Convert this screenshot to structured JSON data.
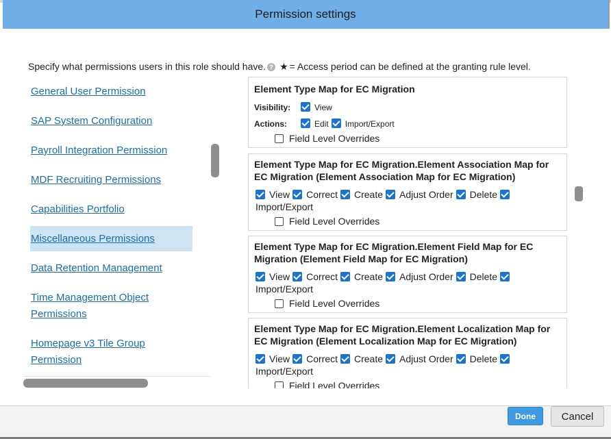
{
  "dialog": {
    "title": "Permission settings",
    "intro_text": "Specify what permissions users in this role should have.",
    "help_icon": "question-circle-icon",
    "star_glyph": "★",
    "access_note": "= Access period can be defined at the granting rule level."
  },
  "sidebar": {
    "items": [
      {
        "label": "General User Permission"
      },
      {
        "label": "SAP System Configuration"
      },
      {
        "label": "Payroll Integration Permission"
      },
      {
        "label": "MDF Recruiting Permissions"
      },
      {
        "label": "Capabilities Portfolio"
      },
      {
        "label": "Miscellaneous Permissions",
        "selected": true
      },
      {
        "label": "Data Retention Management"
      },
      {
        "label": "Time Management Object"
      },
      {
        "label": "Permissions"
      },
      {
        "label": "Homepage v3 Tile Group"
      },
      {
        "label": "Permission"
      }
    ]
  },
  "panels": [
    {
      "title": "Element Type Map for EC Migration",
      "visibility_label": "Visibility:",
      "visibility_options": [
        {
          "label": "View",
          "checked": true
        }
      ],
      "actions_label": "Actions:",
      "actions_options": [
        {
          "label": "Edit",
          "checked": true
        },
        {
          "label": "Import/Export",
          "checked": true
        }
      ],
      "field_overrides": {
        "label": "Field Level Overrides",
        "checked": false
      }
    },
    {
      "title": "Element Type Map for EC Migration.Element Association Map for EC Migration (Element Association Map for EC Migration)",
      "perms": [
        {
          "label": "View",
          "checked": true
        },
        {
          "label": "Correct",
          "checked": true
        },
        {
          "label": "Create",
          "checked": true
        },
        {
          "label": "Adjust Order",
          "checked": true
        },
        {
          "label": "Delete",
          "checked": true
        },
        {
          "label": "Import/Export",
          "checked": true
        }
      ],
      "field_overrides": {
        "label": "Field Level Overrides",
        "checked": false
      }
    },
    {
      "title": "Element Type Map for EC Migration.Element Field Map for EC Migration (Element Field Map for EC Migration)",
      "perms": [
        {
          "label": "View",
          "checked": true
        },
        {
          "label": "Correct",
          "checked": true
        },
        {
          "label": "Create",
          "checked": true
        },
        {
          "label": "Adjust Order",
          "checked": true
        },
        {
          "label": "Delete",
          "checked": true
        },
        {
          "label": "Import/Export",
          "checked": true
        }
      ],
      "field_overrides": {
        "label": "Field Level Overrides",
        "checked": false
      }
    },
    {
      "title": "Element Type Map for EC Migration.Element Localization Map for EC Migration (Element Localization Map for EC Migration)",
      "perms": [
        {
          "label": "View",
          "checked": true
        },
        {
          "label": "Correct",
          "checked": true
        },
        {
          "label": "Create",
          "checked": true
        },
        {
          "label": "Adjust Order",
          "checked": true
        },
        {
          "label": "Delete",
          "checked": true
        },
        {
          "label": "Import/Export",
          "checked": true
        }
      ],
      "field_overrides": {
        "label": "Field Level Overrides",
        "checked": false
      }
    }
  ],
  "footer": {
    "done_label": "Done",
    "cancel_label": "Cancel"
  },
  "colors": {
    "header_bg": "#6faee6",
    "link": "#1a6eb3",
    "selected_bg": "#cde5f3",
    "checkbox": "#1a73d6",
    "done_bg": "#3e9be3"
  }
}
